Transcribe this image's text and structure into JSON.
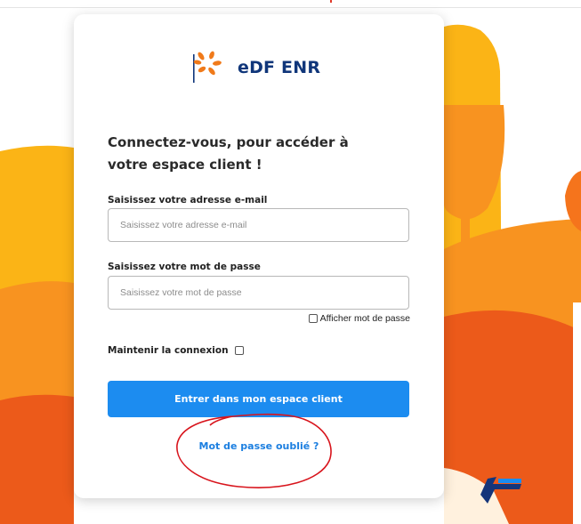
{
  "brand": {
    "name": "EDF ENR",
    "logo_text": "eDF ENR",
    "colors": {
      "navy": "#10367a",
      "orange": "#f07a1a",
      "blue": "#1c8cf0"
    }
  },
  "login": {
    "heading": "Connectez-vous, pour accéder à votre espace client !",
    "email_label": "Saisissez votre adresse e-mail",
    "email_placeholder": "Saisissez votre adresse e-mail",
    "email_value": "",
    "password_label": "Saisissez votre mot de passe",
    "password_placeholder": "Saisissez votre mot de passe",
    "password_value": "",
    "show_password_label": "Afficher mot de passe",
    "show_password_checked": false,
    "remember_label": "Maintenir la connexion",
    "remember_checked": false,
    "submit_label": "Entrer dans mon espace client",
    "forgot_label": "Mot de passe oublié ?"
  },
  "background": {
    "palette": [
      "#fbb416",
      "#f89320",
      "#f5741c",
      "#ec5a1a",
      "#fff1de"
    ]
  }
}
